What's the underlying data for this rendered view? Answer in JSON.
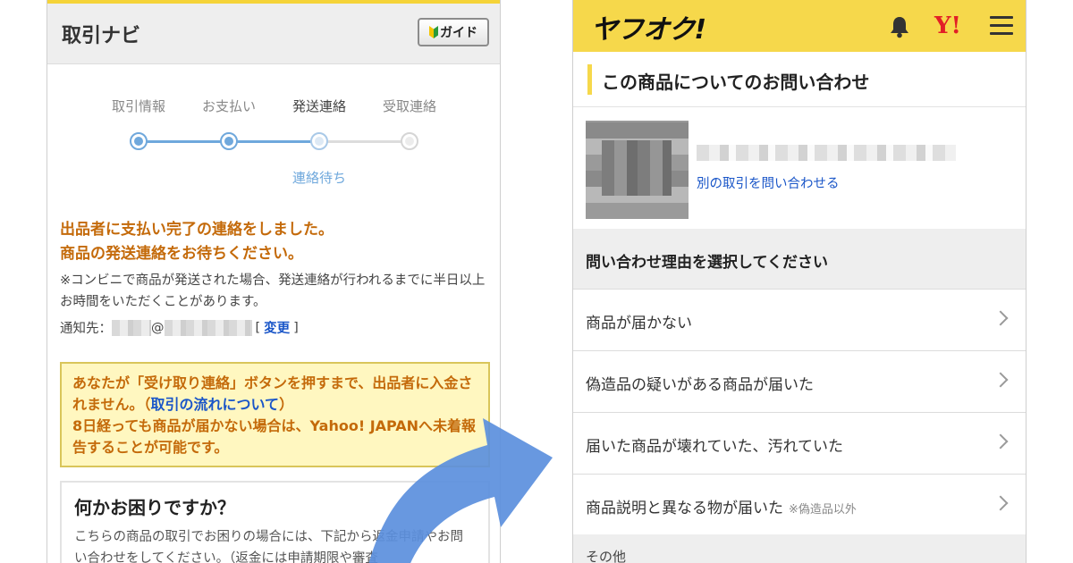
{
  "left": {
    "title": "取引ナビ",
    "guide_label": "ガイド",
    "steps": [
      "取引情報",
      "お支払い",
      "発送連絡",
      "受取連絡"
    ],
    "current_step_index": 2,
    "waiting_label": "連絡待ち",
    "status_line1": "出品者に支払い完了の連絡をしました。",
    "status_line2": "商品の発送連絡をお待ちください。",
    "note_text": "※コンビニで商品が発送された場合、発送連絡が行われるまでに半日以上お時間をいただくことがあります。",
    "notify_label": "通知先：",
    "notify_at": "@",
    "change_open": "[",
    "change_label": "変更",
    "change_close": "]",
    "notice_part1": "あなたが「受け取り連絡」ボタンを押すまで、出品者に入金されません。（",
    "notice_link": "取引の流れについて",
    "notice_part2": "）",
    "notice_part3": "8日経っても商品が届かない場合は、Yahoo! JAPANへ未着報告することが可能です。",
    "trouble_title": "何かお困りですか？",
    "trouble_text": "こちらの商品の取引でお困りの場合には、下記から返金申請やお問い合わせをしてください。（返金には申請期限や審査"
  },
  "right": {
    "logo": "ヤフオク!",
    "yahoo_mark": "Y!",
    "section_title": "この商品についてのお問い合わせ",
    "product_link": "別の取引を問い合わせる",
    "reason_header": "問い合わせ理由を選択してください",
    "reasons": [
      {
        "label": "商品が届かない",
        "sub": ""
      },
      {
        "label": "偽造品の疑いがある商品が届いた",
        "sub": ""
      },
      {
        "label": "届いた商品が壊れていた、汚れていた",
        "sub": ""
      },
      {
        "label": "商品説明と異なる物が届いた",
        "sub": "※偽造品以外"
      }
    ],
    "other_label": "その他"
  },
  "colors": {
    "brand_yellow": "#f6d84b",
    "link_blue": "#1a56c8",
    "status_orange": "#c46a0a",
    "step_blue": "#6fa8dc",
    "arrow_blue": "#5b8fdd",
    "yahoo_red": "#e21f26"
  }
}
